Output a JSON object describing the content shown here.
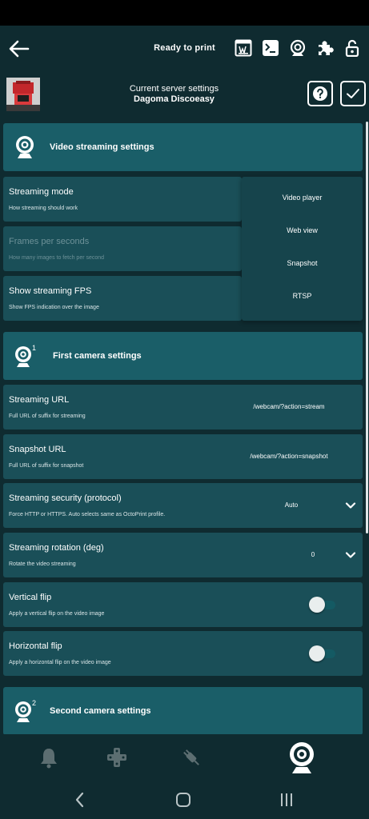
{
  "header": {
    "title": "Ready to print",
    "icons": [
      "back-arrow-icon",
      "web-page-icon",
      "terminal-icon",
      "webcam-icon",
      "puzzle-icon",
      "unlock-icon"
    ]
  },
  "server": {
    "caption": "Current server settings",
    "name": "Dagoma Discoeasy",
    "help_icon": "help-icon",
    "confirm_icon": "checkmark-icon"
  },
  "sections": {
    "video": {
      "title": "Video streaming settings"
    },
    "first_camera": {
      "title": "First camera settings",
      "index": "1"
    },
    "second_camera": {
      "title": "Second camera settings",
      "index": "2"
    }
  },
  "rows": {
    "streaming_mode": {
      "title": "Streaming mode",
      "subtitle": "How streaming should work"
    },
    "fps": {
      "title": "Frames per seconds",
      "subtitle": "How many images to fetch per second"
    },
    "show_fps": {
      "title": "Show streaming FPS",
      "subtitle": "Show FPS indication over the image"
    },
    "streaming_url": {
      "title": "Streaming URL",
      "subtitle": "Full URL of suffix for streaming",
      "value": "/webcam/?action=stream"
    },
    "snapshot_url": {
      "title": "Snapshot URL",
      "subtitle": "Full URL of suffix for snapshot",
      "value": "/webcam/?action=snapshot"
    },
    "security": {
      "title": "Streaming security (protocol)",
      "subtitle": "Force HTTP or HTTPS. Auto selects same as OctoPrint profile.",
      "value": "Auto"
    },
    "rotation": {
      "title": "Streaming rotation (deg)",
      "subtitle": "Rotate the video streaming",
      "value": "0"
    },
    "vflip": {
      "title": "Vertical flip",
      "subtitle": "Apply a vertical flip on the video image",
      "on": false
    },
    "hflip": {
      "title": "Horizontal flip",
      "subtitle": "Apply a horizontal flip on the video image",
      "on": false
    }
  },
  "streaming_mode_options": [
    "Video player",
    "Web view",
    "Snapshot",
    "RTSP"
  ],
  "bottom_nav": [
    "bell-icon",
    "gamepad-icon",
    "plug-icon",
    "webcam-icon"
  ],
  "system_nav": [
    "back-icon",
    "home-icon",
    "recents-icon"
  ],
  "colors": {
    "background": "#0f2b30",
    "section_header": "#1a5e68",
    "row": "#1a4f58",
    "dropdown": "#16444c",
    "toggle_track": "#145a63"
  }
}
